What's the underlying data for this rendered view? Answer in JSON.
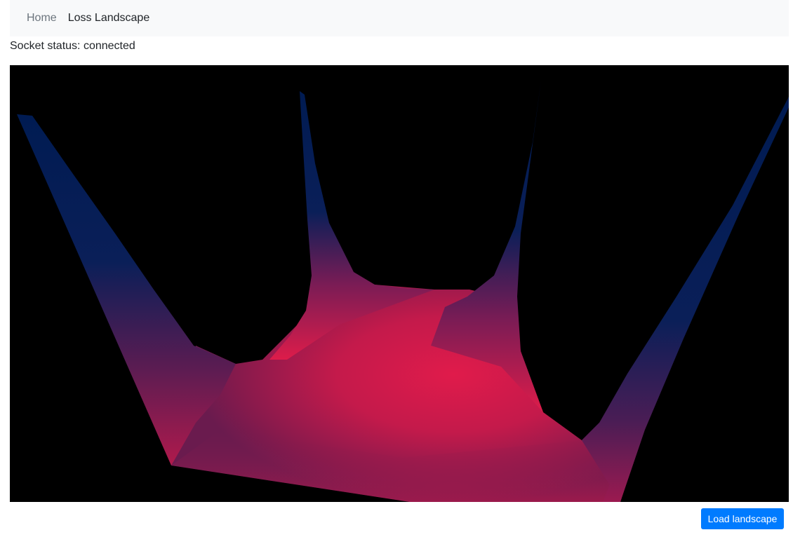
{
  "navbar": {
    "home_label": "Home",
    "active_label": "Loss Landscape"
  },
  "status": {
    "text": "Socket status: connected"
  },
  "viewer": {
    "background_color": "#000000",
    "surface_low_color": "#dd1c4a",
    "surface_high_color": "#001b52"
  },
  "actions": {
    "load_label": "Load landscape",
    "button_color": "#007bff"
  }
}
